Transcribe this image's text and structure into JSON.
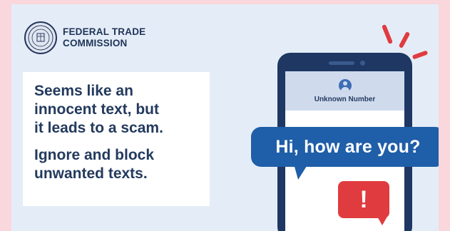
{
  "colors": {
    "page_background": "#f9d7dc",
    "card_background": "#e4edf7",
    "navy": "#1e3763",
    "bubble_blue": "#1f5ea8",
    "alert_red": "#e03b3f"
  },
  "logo": {
    "icon": "ftc-seal-icon",
    "line1": "FEDERAL TRADE",
    "line2": "COMMISSION"
  },
  "message": {
    "paragraph1_line1": "Seems like an",
    "paragraph1_line2": "innocent text, but",
    "paragraph1_line3": "it leads to a scam.",
    "paragraph2_line1": "Ignore and block",
    "paragraph2_line2": "unwanted texts."
  },
  "phone": {
    "contact_icon": "person-avatar-icon",
    "contact_name": "Unknown Number"
  },
  "chat_bubble": {
    "text": "Hi, how are you?"
  },
  "alert_bubble": {
    "icon": "exclamation-icon",
    "text": "!"
  }
}
